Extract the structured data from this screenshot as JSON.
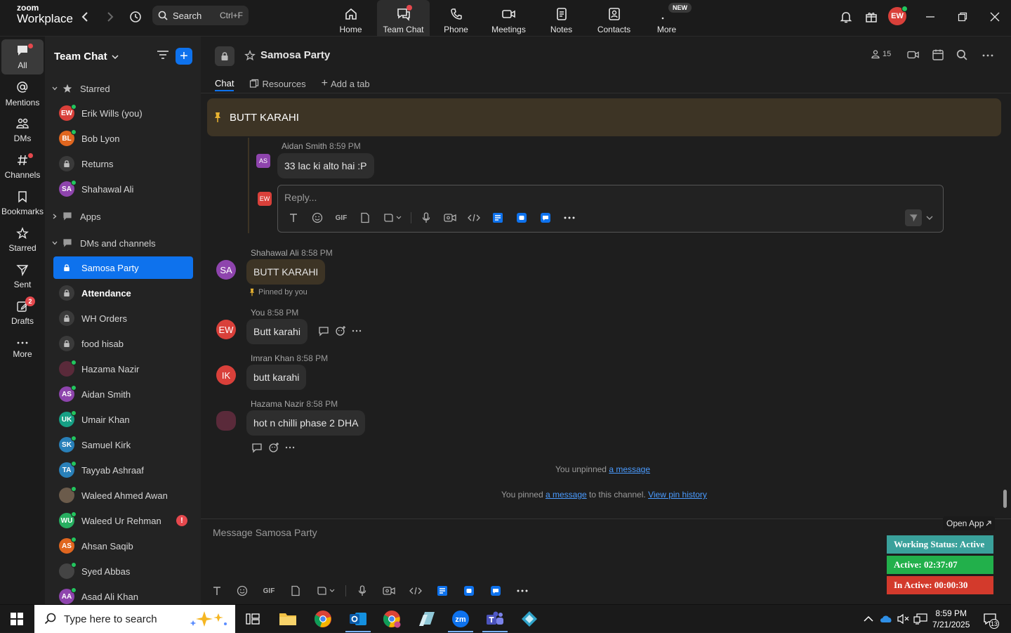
{
  "app": {
    "brand_top": "zoom",
    "brand_bottom": "Workplace",
    "search_label": "Search",
    "search_shortcut": "Ctrl+F",
    "user_initials": "EW"
  },
  "top_nav": [
    {
      "label": "Home",
      "icon": "home-icon"
    },
    {
      "label": "Team Chat",
      "icon": "chat-icon"
    },
    {
      "label": "Phone",
      "icon": "phone-icon"
    },
    {
      "label": "Meetings",
      "icon": "video-icon"
    },
    {
      "label": "Notes",
      "icon": "notes-icon"
    },
    {
      "label": "Contacts",
      "icon": "contacts-icon"
    },
    {
      "label": "More",
      "icon": "more-icon"
    }
  ],
  "new_badge": "NEW",
  "rail": [
    {
      "label": "All"
    },
    {
      "label": "Mentions"
    },
    {
      "label": "DMs"
    },
    {
      "label": "Channels"
    },
    {
      "label": "Bookmarks"
    },
    {
      "label": "Starred"
    },
    {
      "label": "Sent"
    },
    {
      "label": "Drafts",
      "badge": "2"
    },
    {
      "label": "More"
    }
  ],
  "sidebar": {
    "title": "Team Chat",
    "sections": {
      "starred": "Starred",
      "apps": "Apps",
      "dms_channels": "DMs and channels"
    },
    "starred_items": [
      {
        "name": "Erik Wills (you)",
        "initials": "EW",
        "color": "#d9403a",
        "type": "person"
      },
      {
        "name": "Bob Lyon",
        "initials": "BL",
        "color": "#e0661f",
        "type": "person"
      },
      {
        "name": "Returns",
        "type": "channel"
      },
      {
        "name": "Shahawal Ali",
        "initials": "SA",
        "color": "#8e44ad",
        "type": "person"
      }
    ],
    "channel_items": [
      {
        "name": "Samosa Party",
        "type": "channel",
        "active": true
      },
      {
        "name": "Attendance",
        "type": "channel",
        "bold": true
      },
      {
        "name": "WH Orders",
        "type": "channel"
      },
      {
        "name": "food hisab",
        "type": "channel"
      },
      {
        "name": "Hazama Nazir",
        "initials": "",
        "color": "#5a2a3a",
        "type": "person"
      },
      {
        "name": "Aidan Smith",
        "initials": "AS",
        "color": "#8e44ad",
        "type": "person"
      },
      {
        "name": "Umair Khan",
        "initials": "UK",
        "color": "#16a085",
        "type": "person"
      },
      {
        "name": "Samuel Kirk",
        "initials": "SK",
        "color": "#2980b9",
        "type": "person"
      },
      {
        "name": "Tayyab Ashraaf",
        "initials": "TA",
        "color": "#2980b9",
        "type": "person"
      },
      {
        "name": "Waleed Ahmed Awan",
        "initials": "",
        "color": "#6b5b4b",
        "type": "person"
      },
      {
        "name": "Waleed Ur Rehman",
        "initials": "WU",
        "color": "#27ae60",
        "type": "person",
        "alert": "!"
      },
      {
        "name": "Ahsan Saqib",
        "initials": "AS",
        "color": "#e0661f",
        "type": "person"
      },
      {
        "name": "Syed Abbas",
        "initials": "",
        "color": "#444444",
        "type": "person"
      },
      {
        "name": "Asad Ali Khan",
        "initials": "AA",
        "color": "#8e44ad",
        "type": "person"
      }
    ]
  },
  "channel": {
    "name": "Samosa Party",
    "member_count": "15",
    "tabs": [
      "Chat",
      "Resources",
      "Add a tab"
    ]
  },
  "pinned_banner": "BUTT KARAHI",
  "thread": {
    "author": "Aidan Smith",
    "time": "8:59 PM",
    "initials": "AS",
    "text": "33 lac ki alto hai :P",
    "reply_initials": "EW",
    "reply_placeholder": "Reply...",
    "gif_label": "GIF"
  },
  "messages": [
    {
      "author": "Shahawal Ali",
      "time": "8:58 PM",
      "initials": "SA",
      "color": "#8e44ad",
      "text": "BUTT KARAHI",
      "pinned_note": "Pinned by you"
    },
    {
      "author": "You",
      "time": "8:58 PM",
      "initials": "EW",
      "color": "#d9403a",
      "text": "Butt karahi"
    },
    {
      "author": "Imran Khan",
      "time": "8:58 PM",
      "initials": "IK",
      "color": "#d9403a",
      "text": "butt karahi"
    },
    {
      "author": "Hazama Nazir",
      "time": "8:58 PM",
      "initials": "",
      "color": "#5a2a3a",
      "text": "hot n chilli phase 2 DHA"
    }
  ],
  "system": {
    "unpinned_prefix": "You unpinned",
    "unpinned_link": "a message",
    "pinned_prefix": "You pinned",
    "pinned_link": "a message",
    "pinned_suffix": "to this channel.",
    "history_link": "View pin history"
  },
  "composer": {
    "placeholder": "Message Samosa Party",
    "gif_label": "GIF"
  },
  "overlay": {
    "open_app": "Open App",
    "working_status": "Working Status: Active",
    "active": "Active: 02:37:07",
    "inactive": "In Active: 00:00:30",
    "colors": {
      "status": "#3aa19b",
      "active": "#22b04b",
      "inactive": "#d33a2c"
    }
  },
  "taskbar": {
    "search_placeholder": "Type here to search",
    "time": "8:59 PM",
    "date": "7/21/2025",
    "notif_count": "13"
  },
  "colors": {
    "accent": "#0e72ed",
    "pin": "#3d3425",
    "online": "#22c55e",
    "alert": "#e5484d"
  }
}
